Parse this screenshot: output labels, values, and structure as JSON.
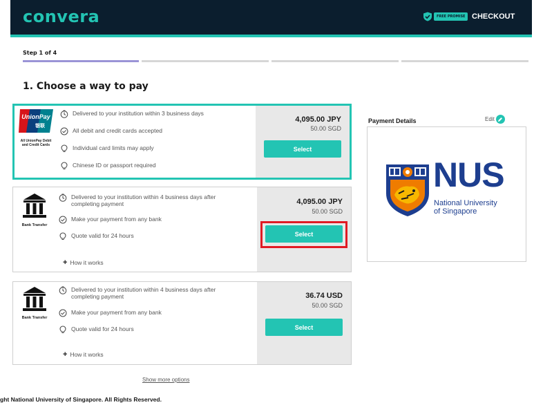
{
  "header": {
    "logo": "convera",
    "promise_badge": "FREE PROMISE",
    "checkout": "CHECKOUT"
  },
  "steps": {
    "label": "Step 1 of 4",
    "current": 1,
    "total": 4
  },
  "page_title": "1. Choose a way to pay",
  "options": [
    {
      "method_logo": "UnionPay 银联",
      "method_caption": "All UnionPay Debit and Credit Cards",
      "features": [
        {
          "icon": "clock-icon",
          "text": "Delivered to your institution within 3 business days"
        },
        {
          "icon": "check-circle-icon",
          "text": "All debit and credit cards accepted"
        },
        {
          "icon": "lightbulb-icon",
          "text": "Individual card limits may apply"
        },
        {
          "icon": "lightbulb-icon",
          "text": "Chinese ID or passport required"
        }
      ],
      "price": "4,095.00 JPY",
      "price_sgd": "50.00 SGD",
      "select_label": "Select",
      "selected": true
    },
    {
      "method_caption": "Bank Transfer",
      "features": [
        {
          "icon": "clock-icon",
          "text": "Delivered to your institution within 4 business days after completing payment"
        },
        {
          "icon": "check-circle-icon",
          "text": "Make your payment from any bank"
        },
        {
          "icon": "lightbulb-icon",
          "text": "Quote valid for 24 hours"
        }
      ],
      "how_label": "How it works",
      "price": "4,095.00 JPY",
      "price_sgd": "50.00 SGD",
      "select_label": "Select"
    },
    {
      "method_caption": "Bank Transfer",
      "features": [
        {
          "icon": "clock-icon",
          "text": "Delivered to your institution within 4 business days after completing payment"
        },
        {
          "icon": "check-circle-icon",
          "text": "Make your payment from any bank"
        },
        {
          "icon": "lightbulb-icon",
          "text": "Quote valid for 24 hours"
        }
      ],
      "how_label": "How it works",
      "price": "36.74 USD",
      "price_sgd": "50.00 SGD",
      "select_label": "Select"
    }
  ],
  "payment_details": {
    "label": "Payment Details",
    "edit": "Edit",
    "logo_big": "NUS",
    "logo_line1": "National University",
    "logo_line2": "of Singapore"
  },
  "show_more": "Show more options",
  "footer": "ght National University of Singapore. All Rights Reserved.",
  "colors": {
    "header_bg": "#0b1e2e",
    "accent": "#23c4b3",
    "progress_active": "#9a94d6",
    "highlight_red": "#e01b24",
    "nus_blue": "#1d3e8f",
    "nus_orange": "#ef7c00"
  }
}
